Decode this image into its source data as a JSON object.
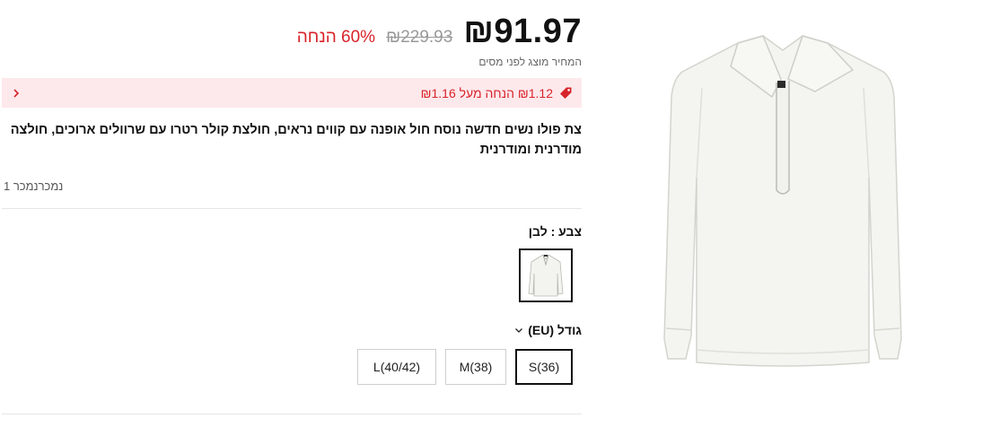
{
  "price": {
    "current": "₪91.97",
    "original": "₪229.93",
    "discount": "60% הנחה",
    "tax_note": "המחיר מוצג לפני מסים"
  },
  "coupon": {
    "text": "₪1.12 הנחה מעל ₪1.16"
  },
  "product": {
    "title": "צת פולו נשים חדשה נוסח חול אופנה עם קווים נראים, חולצת קולר רטרו עם שרוולים ארוכים, חולצה מודרנית ומודרנית",
    "sold": "נמכרנמכר 1"
  },
  "color": {
    "label": "צבע : לבן"
  },
  "size": {
    "label": "גודל (EU)",
    "options": [
      {
        "label": "S(36)",
        "selected": true
      },
      {
        "label": "M(38)",
        "selected": false
      },
      {
        "label": "L(40/42)",
        "selected": false
      }
    ]
  },
  "colors": {
    "accent": "#d8232a",
    "banner_bg": "#fde9ec"
  }
}
